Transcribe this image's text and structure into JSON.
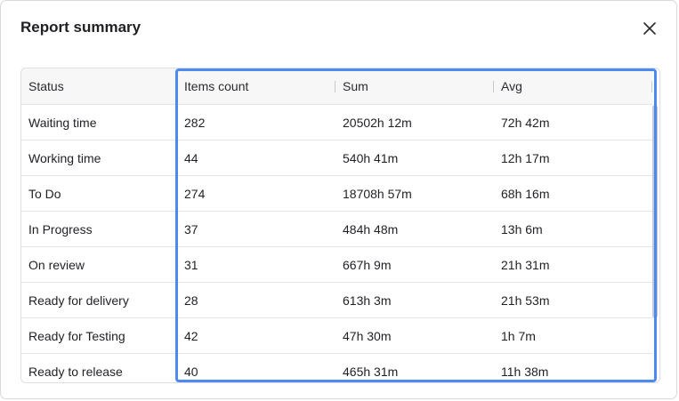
{
  "dialog": {
    "title": "Report summary",
    "close_icon": "close-icon"
  },
  "table": {
    "headers": {
      "status": "Status",
      "items_count": "Items count",
      "sum": "Sum",
      "avg": "Avg"
    },
    "rows": [
      {
        "status": "Waiting time",
        "items_count": "282",
        "sum": "20502h 12m",
        "avg": "72h 42m"
      },
      {
        "status": "Working time",
        "items_count": "44",
        "sum": "540h 41m",
        "avg": "12h 17m"
      },
      {
        "status": "To Do",
        "items_count": "274",
        "sum": "18708h 57m",
        "avg": "68h 16m"
      },
      {
        "status": "In Progress",
        "items_count": "37",
        "sum": "484h 48m",
        "avg": "13h 6m"
      },
      {
        "status": "On review",
        "items_count": "31",
        "sum": "667h 9m",
        "avg": "21h 31m"
      },
      {
        "status": "Ready for delivery",
        "items_count": "28",
        "sum": "613h 3m",
        "avg": "21h 53m"
      },
      {
        "status": "Ready for Testing",
        "items_count": "42",
        "sum": "47h 30m",
        "avg": "1h 7m"
      },
      {
        "status": "Ready to release",
        "items_count": "40",
        "sum": "465h 31m",
        "avg": "11h 38m"
      }
    ]
  },
  "colors": {
    "highlight": "#4b8af0",
    "header_bg": "#f7f7f8",
    "border": "#e4e4e8"
  }
}
